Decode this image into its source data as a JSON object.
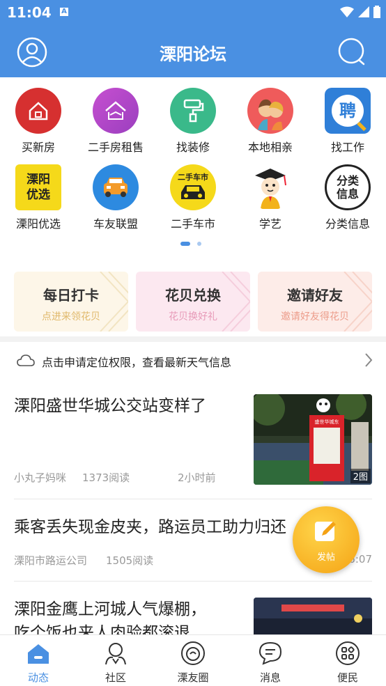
{
  "status_bar": {
    "time": "11:04",
    "a_badge": "A"
  },
  "header": {
    "title": "溧阳论坛"
  },
  "grid": [
    {
      "label": "买新房",
      "icon": "house-icon",
      "color": "#d63030"
    },
    {
      "label": "二手房租售",
      "icon": "handshake-house-icon",
      "color": "#b84cc7"
    },
    {
      "label": "找装修",
      "icon": "paint-roller-icon",
      "color": "#3ab98a"
    },
    {
      "label": "本地相亲",
      "icon": "couple-icon",
      "color": "#ef5b5b"
    },
    {
      "label": "找工作",
      "icon": "recruit-icon",
      "color": "#2f7fd8",
      "icon_text": "聘"
    },
    {
      "label": "溧阳优选",
      "icon": "liyang-select-icon",
      "color": "#f5d91a",
      "icon_text": "溧阳优选"
    },
    {
      "label": "车友联盟",
      "icon": "car-icon",
      "color": "#2d8ae0"
    },
    {
      "label": "二手车市",
      "icon": "used-car-icon",
      "color": "#f5d91a",
      "icon_text": "二手车市"
    },
    {
      "label": "学艺",
      "icon": "graduate-icon",
      "color": "#ffffff"
    },
    {
      "label": "分类信息",
      "icon": "classified-icon",
      "color": "#ffffff",
      "icon_text": "分类信息"
    }
  ],
  "feature_cards": [
    {
      "title": "每日打卡",
      "subtitle": "点进来领花贝",
      "bg": "#fdf6e8",
      "sub_color": "#e0b86a"
    },
    {
      "title": "花贝兑换",
      "subtitle": "花贝换好礼",
      "bg": "#fce8f0",
      "sub_color": "#e79ab8"
    },
    {
      "title": "邀请好友",
      "subtitle": "邀请好友得花贝",
      "bg": "#fdece8",
      "sub_color": "#ec9c8a"
    }
  ],
  "weather": {
    "text": "点击申请定位权限，查看最新天气信息"
  },
  "articles": [
    {
      "title": "溧阳盛世华城公交站变样了",
      "author": "小丸子妈咪",
      "reads": "1373阅读",
      "time": "2小时前",
      "image_badge": "2图",
      "sign_text": "盛世华城东"
    },
    {
      "title": "乘客丢失现金皮夹，路运员工助力归还",
      "author": "溧阳市路运公司",
      "reads": "1505阅读",
      "time": "16:07"
    },
    {
      "title": "溧阳金鹰上河城人气爆棚，",
      "title_line2": "吃个饭也来人肉验都滚退"
    }
  ],
  "fab": {
    "label": "发帖"
  },
  "tabs": [
    {
      "label": "动态",
      "icon": "home-icon",
      "active": true
    },
    {
      "label": "社区",
      "icon": "community-icon",
      "active": false
    },
    {
      "label": "溧友圈",
      "icon": "friends-circle-icon",
      "active": false
    },
    {
      "label": "消息",
      "icon": "message-icon",
      "active": false
    },
    {
      "label": "便民",
      "icon": "services-icon",
      "active": false
    }
  ],
  "colors": {
    "primary": "#4a90e2"
  }
}
